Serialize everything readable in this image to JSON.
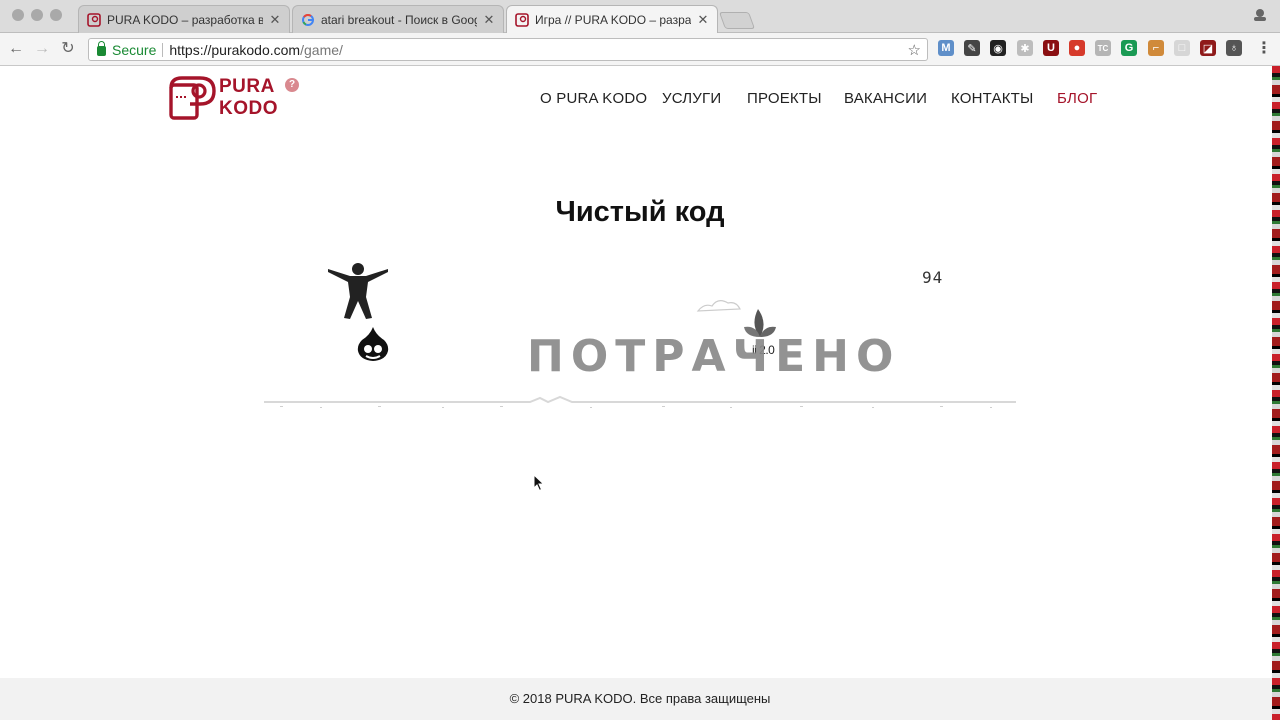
{
  "browser": {
    "tabs": [
      {
        "title": "PURA KODO – разработка веб",
        "active": false,
        "favicon": "purakodo-favicon"
      },
      {
        "title": "atari breakout - Поиск в Goog",
        "active": false,
        "favicon": "google-g-icon"
      },
      {
        "title": "Игра // PURA KODO – разраб",
        "active": true,
        "favicon": "purakodo-favicon"
      }
    ],
    "close_glyph": "✕",
    "address": {
      "secure_label": "Secure",
      "url_host": "https://purakodo.com",
      "url_path": "/game/"
    },
    "extensions": [
      {
        "icon": "gmail-icon",
        "color": "#5f8fc9",
        "glyph": "M"
      },
      {
        "icon": "pen-icon",
        "color": "#444444",
        "glyph": "✎"
      },
      {
        "icon": "camera-icon",
        "color": "#222222",
        "glyph": "◉"
      },
      {
        "icon": "puzzle-icon",
        "color": "#bdbdbd",
        "glyph": "✱"
      },
      {
        "icon": "ublock-icon",
        "color": "#8a0f12",
        "glyph": "U"
      },
      {
        "icon": "record-icon",
        "color": "#d63a2b",
        "glyph": "●"
      },
      {
        "icon": "tc-icon",
        "color": "#b5b5b5",
        "glyph": "TC"
      },
      {
        "icon": "grammarly-icon",
        "color": "#1a9a54",
        "glyph": "G"
      },
      {
        "icon": "rss-icon",
        "color": "#d08a3a",
        "glyph": "⌐"
      },
      {
        "icon": "square-icon",
        "color": "#d6d6d6",
        "glyph": "□"
      },
      {
        "icon": "bookmark-icon",
        "color": "#8f1a1a",
        "glyph": "◪"
      },
      {
        "icon": "dropper-icon",
        "color": "#555555",
        "glyph": "♁"
      }
    ]
  },
  "site": {
    "logo": {
      "line1": "PURA",
      "line2": "KODO",
      "badge": "?"
    },
    "nav": [
      "О PURA KODO",
      "УСЛУГИ",
      "ПРОЕКТЫ",
      "ВАКАНСИИ",
      "КОНТАКТЫ",
      "БЛОГ"
    ],
    "brand_color": "#a5142a"
  },
  "page": {
    "title": "Чистый код",
    "game": {
      "score": "94",
      "overlay": "ПОТРАЧЕНО",
      "obstacle_label": "ii 2.0"
    }
  },
  "footer": {
    "text": "© 2018 PURA KODO. Все права защищены"
  }
}
